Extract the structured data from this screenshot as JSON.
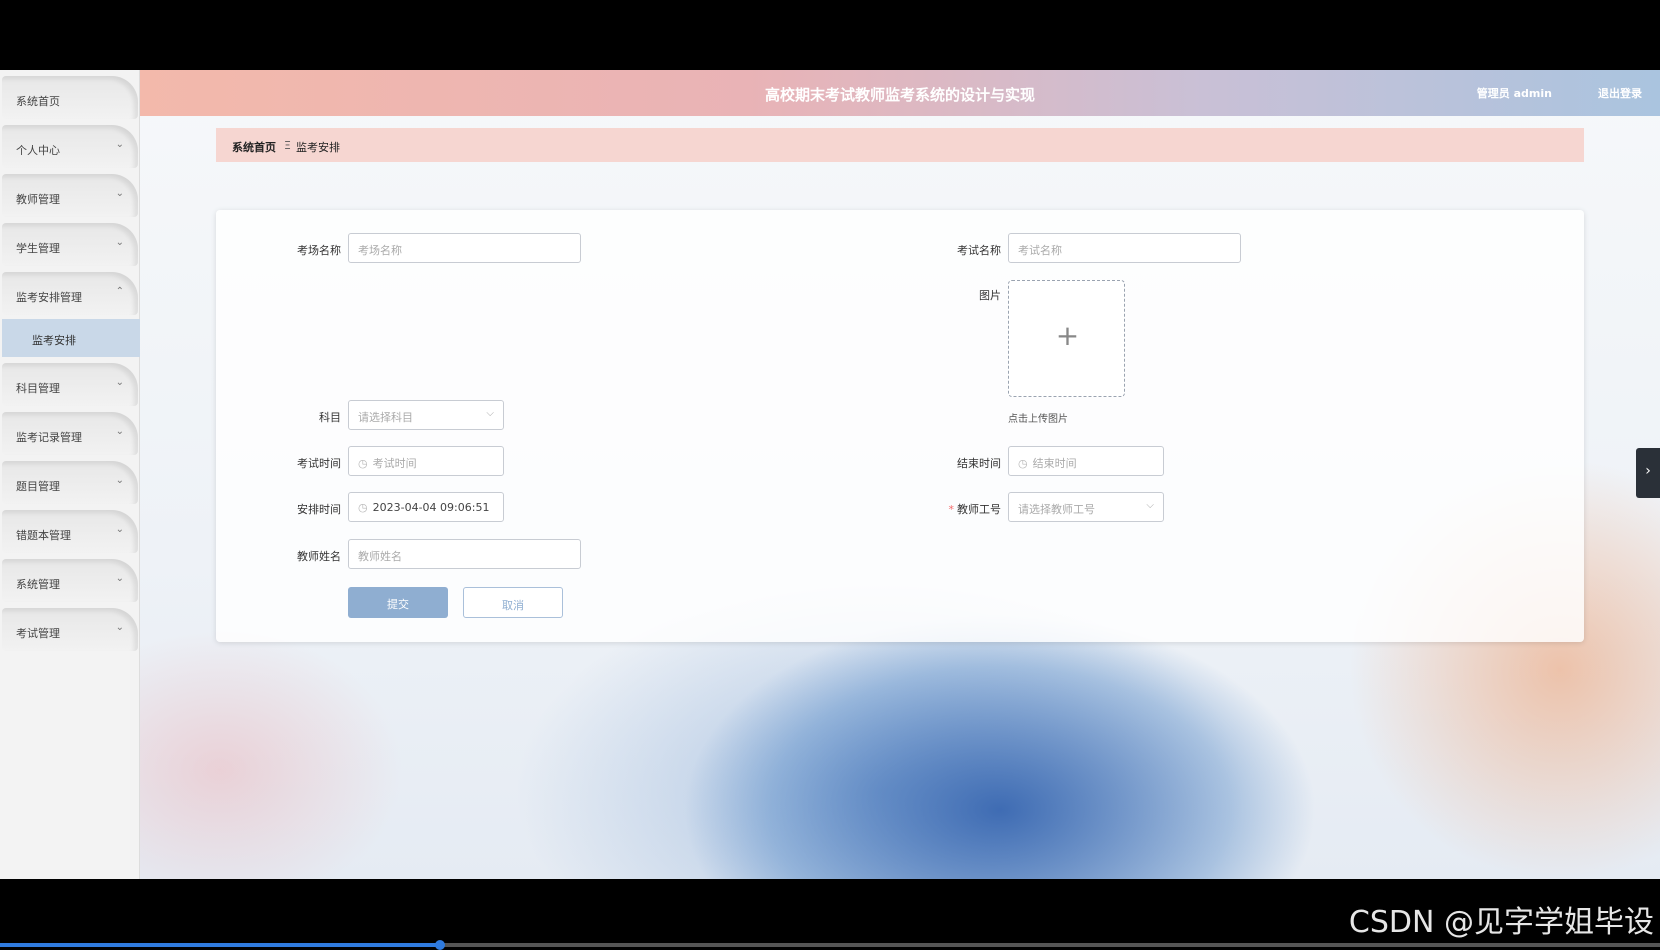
{
  "header": {
    "title": "高校期末考试教师监考系统的设计与实现",
    "user": "管理员 admin",
    "logout": "退出登录"
  },
  "sidebar": {
    "items": [
      {
        "label": "系统首页",
        "chevron": ""
      },
      {
        "label": "个人中心",
        "chevron": "⌄"
      },
      {
        "label": "教师管理",
        "chevron": "⌄"
      },
      {
        "label": "学生管理",
        "chevron": "⌄"
      },
      {
        "label": "监考安排管理",
        "chevron": "⌃"
      },
      {
        "label": "科目管理",
        "chevron": "⌄"
      },
      {
        "label": "监考记录管理",
        "chevron": "⌄"
      },
      {
        "label": "题目管理",
        "chevron": "⌄"
      },
      {
        "label": "错题本管理",
        "chevron": "⌄"
      },
      {
        "label": "系统管理",
        "chevron": "⌄"
      },
      {
        "label": "考试管理",
        "chevron": "⌄"
      }
    ],
    "submenu": {
      "label": "监考安排"
    }
  },
  "breadcrumb": {
    "home": "系统首页",
    "sep": "Ξ",
    "current": "监考安排"
  },
  "form": {
    "exam_room": {
      "label": "考场名称",
      "placeholder": "考场名称"
    },
    "exam_name": {
      "label": "考试名称",
      "placeholder": "考试名称"
    },
    "image": {
      "label": "图片",
      "plus": "+",
      "hint": "点击上传图片"
    },
    "subject": {
      "label": "科目",
      "placeholder": "请选择科目"
    },
    "exam_time": {
      "label": "考试时间",
      "placeholder": "考试时间"
    },
    "end_time": {
      "label": "结束时间",
      "placeholder": "结束时间"
    },
    "arrange_time": {
      "label": "安排时间",
      "value": "2023-04-04 09:06:51"
    },
    "teacher_id": {
      "label": "教师工号",
      "placeholder": "请选择教师工号",
      "required_mark": "*"
    },
    "teacher_name": {
      "label": "教师姓名",
      "placeholder": "教师姓名"
    },
    "submit": "提交",
    "cancel": "取消"
  },
  "icons": {
    "clock": "clock-icon",
    "dropdown": "chevron-down-icon",
    "side_tab": "chevron-right-icon"
  },
  "side_tab": {
    "glyph": "›"
  },
  "video": {
    "progress": 0.265
  },
  "watermark": "CSDN @见字学姐毕设"
}
